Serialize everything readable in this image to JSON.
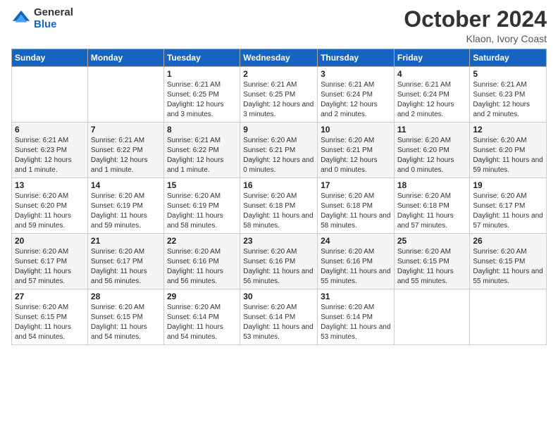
{
  "logo": {
    "general": "General",
    "blue": "Blue"
  },
  "header": {
    "month": "October 2024",
    "location": "Klaon, Ivory Coast"
  },
  "days_of_week": [
    "Sunday",
    "Monday",
    "Tuesday",
    "Wednesday",
    "Thursday",
    "Friday",
    "Saturday"
  ],
  "weeks": [
    [
      {
        "day": "",
        "info": ""
      },
      {
        "day": "",
        "info": ""
      },
      {
        "day": "1",
        "info": "Sunrise: 6:21 AM\nSunset: 6:25 PM\nDaylight: 12 hours and 3 minutes."
      },
      {
        "day": "2",
        "info": "Sunrise: 6:21 AM\nSunset: 6:25 PM\nDaylight: 12 hours and 3 minutes."
      },
      {
        "day": "3",
        "info": "Sunrise: 6:21 AM\nSunset: 6:24 PM\nDaylight: 12 hours and 2 minutes."
      },
      {
        "day": "4",
        "info": "Sunrise: 6:21 AM\nSunset: 6:24 PM\nDaylight: 12 hours and 2 minutes."
      },
      {
        "day": "5",
        "info": "Sunrise: 6:21 AM\nSunset: 6:23 PM\nDaylight: 12 hours and 2 minutes."
      }
    ],
    [
      {
        "day": "6",
        "info": "Sunrise: 6:21 AM\nSunset: 6:23 PM\nDaylight: 12 hours and 1 minute."
      },
      {
        "day": "7",
        "info": "Sunrise: 6:21 AM\nSunset: 6:22 PM\nDaylight: 12 hours and 1 minute."
      },
      {
        "day": "8",
        "info": "Sunrise: 6:21 AM\nSunset: 6:22 PM\nDaylight: 12 hours and 1 minute."
      },
      {
        "day": "9",
        "info": "Sunrise: 6:20 AM\nSunset: 6:21 PM\nDaylight: 12 hours and 0 minutes."
      },
      {
        "day": "10",
        "info": "Sunrise: 6:20 AM\nSunset: 6:21 PM\nDaylight: 12 hours and 0 minutes."
      },
      {
        "day": "11",
        "info": "Sunrise: 6:20 AM\nSunset: 6:20 PM\nDaylight: 12 hours and 0 minutes."
      },
      {
        "day": "12",
        "info": "Sunrise: 6:20 AM\nSunset: 6:20 PM\nDaylight: 11 hours and 59 minutes."
      }
    ],
    [
      {
        "day": "13",
        "info": "Sunrise: 6:20 AM\nSunset: 6:20 PM\nDaylight: 11 hours and 59 minutes."
      },
      {
        "day": "14",
        "info": "Sunrise: 6:20 AM\nSunset: 6:19 PM\nDaylight: 11 hours and 59 minutes."
      },
      {
        "day": "15",
        "info": "Sunrise: 6:20 AM\nSunset: 6:19 PM\nDaylight: 11 hours and 58 minutes."
      },
      {
        "day": "16",
        "info": "Sunrise: 6:20 AM\nSunset: 6:18 PM\nDaylight: 11 hours and 58 minutes."
      },
      {
        "day": "17",
        "info": "Sunrise: 6:20 AM\nSunset: 6:18 PM\nDaylight: 11 hours and 58 minutes."
      },
      {
        "day": "18",
        "info": "Sunrise: 6:20 AM\nSunset: 6:18 PM\nDaylight: 11 hours and 57 minutes."
      },
      {
        "day": "19",
        "info": "Sunrise: 6:20 AM\nSunset: 6:17 PM\nDaylight: 11 hours and 57 minutes."
      }
    ],
    [
      {
        "day": "20",
        "info": "Sunrise: 6:20 AM\nSunset: 6:17 PM\nDaylight: 11 hours and 57 minutes."
      },
      {
        "day": "21",
        "info": "Sunrise: 6:20 AM\nSunset: 6:17 PM\nDaylight: 11 hours and 56 minutes."
      },
      {
        "day": "22",
        "info": "Sunrise: 6:20 AM\nSunset: 6:16 PM\nDaylight: 11 hours and 56 minutes."
      },
      {
        "day": "23",
        "info": "Sunrise: 6:20 AM\nSunset: 6:16 PM\nDaylight: 11 hours and 56 minutes."
      },
      {
        "day": "24",
        "info": "Sunrise: 6:20 AM\nSunset: 6:16 PM\nDaylight: 11 hours and 55 minutes."
      },
      {
        "day": "25",
        "info": "Sunrise: 6:20 AM\nSunset: 6:15 PM\nDaylight: 11 hours and 55 minutes."
      },
      {
        "day": "26",
        "info": "Sunrise: 6:20 AM\nSunset: 6:15 PM\nDaylight: 11 hours and 55 minutes."
      }
    ],
    [
      {
        "day": "27",
        "info": "Sunrise: 6:20 AM\nSunset: 6:15 PM\nDaylight: 11 hours and 54 minutes."
      },
      {
        "day": "28",
        "info": "Sunrise: 6:20 AM\nSunset: 6:15 PM\nDaylight: 11 hours and 54 minutes."
      },
      {
        "day": "29",
        "info": "Sunrise: 6:20 AM\nSunset: 6:14 PM\nDaylight: 11 hours and 54 minutes."
      },
      {
        "day": "30",
        "info": "Sunrise: 6:20 AM\nSunset: 6:14 PM\nDaylight: 11 hours and 53 minutes."
      },
      {
        "day": "31",
        "info": "Sunrise: 6:20 AM\nSunset: 6:14 PM\nDaylight: 11 hours and 53 minutes."
      },
      {
        "day": "",
        "info": ""
      },
      {
        "day": "",
        "info": ""
      }
    ]
  ]
}
